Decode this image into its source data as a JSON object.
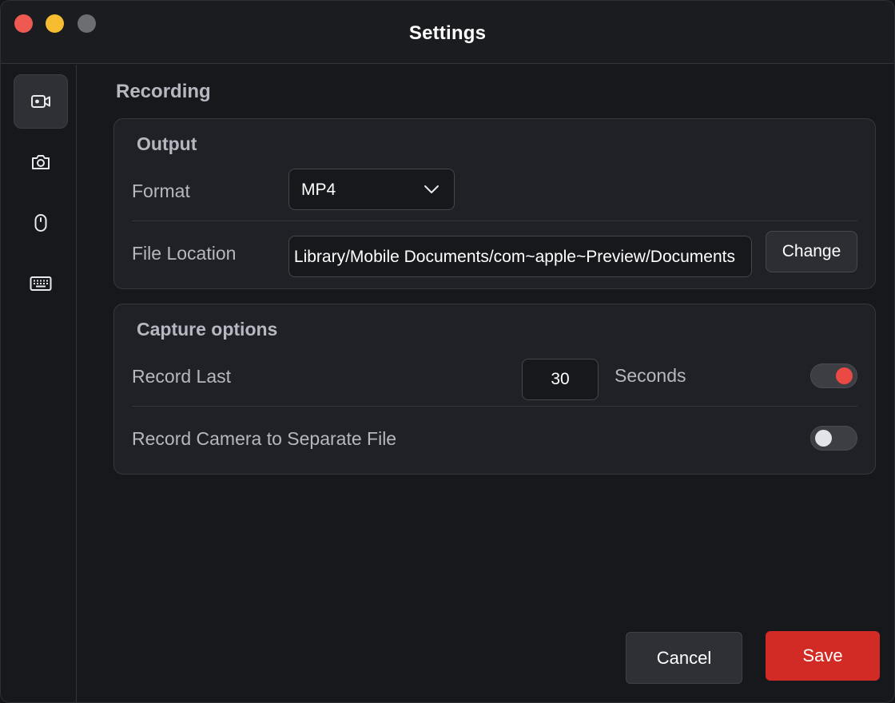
{
  "window": {
    "title": "Settings"
  },
  "sidebar": {
    "items": [
      {
        "icon": "video-camera-icon",
        "active": true
      },
      {
        "icon": "camera-icon",
        "active": false
      },
      {
        "icon": "mouse-icon",
        "active": false
      },
      {
        "icon": "keyboard-icon",
        "active": false
      }
    ]
  },
  "main": {
    "section_title": "Recording",
    "output": {
      "title": "Output",
      "format_label": "Format",
      "format_value": "MP4",
      "location_label": "File Location",
      "location_value": "Library/Mobile Documents/com~apple~Preview/Documents",
      "change_label": "Change"
    },
    "capture": {
      "title": "Capture options",
      "record_last_label": "Record Last",
      "record_last_value": "30",
      "seconds_label": "Seconds",
      "record_last_enabled": true,
      "camera_label": "Record Camera to Separate File",
      "camera_enabled": false
    }
  },
  "footer": {
    "cancel_label": "Cancel",
    "save_label": "Save"
  },
  "colors": {
    "accent": "#d22a24",
    "toggle_on_knob": "#ea4a43",
    "background": "#17181c",
    "card": "#202127"
  }
}
